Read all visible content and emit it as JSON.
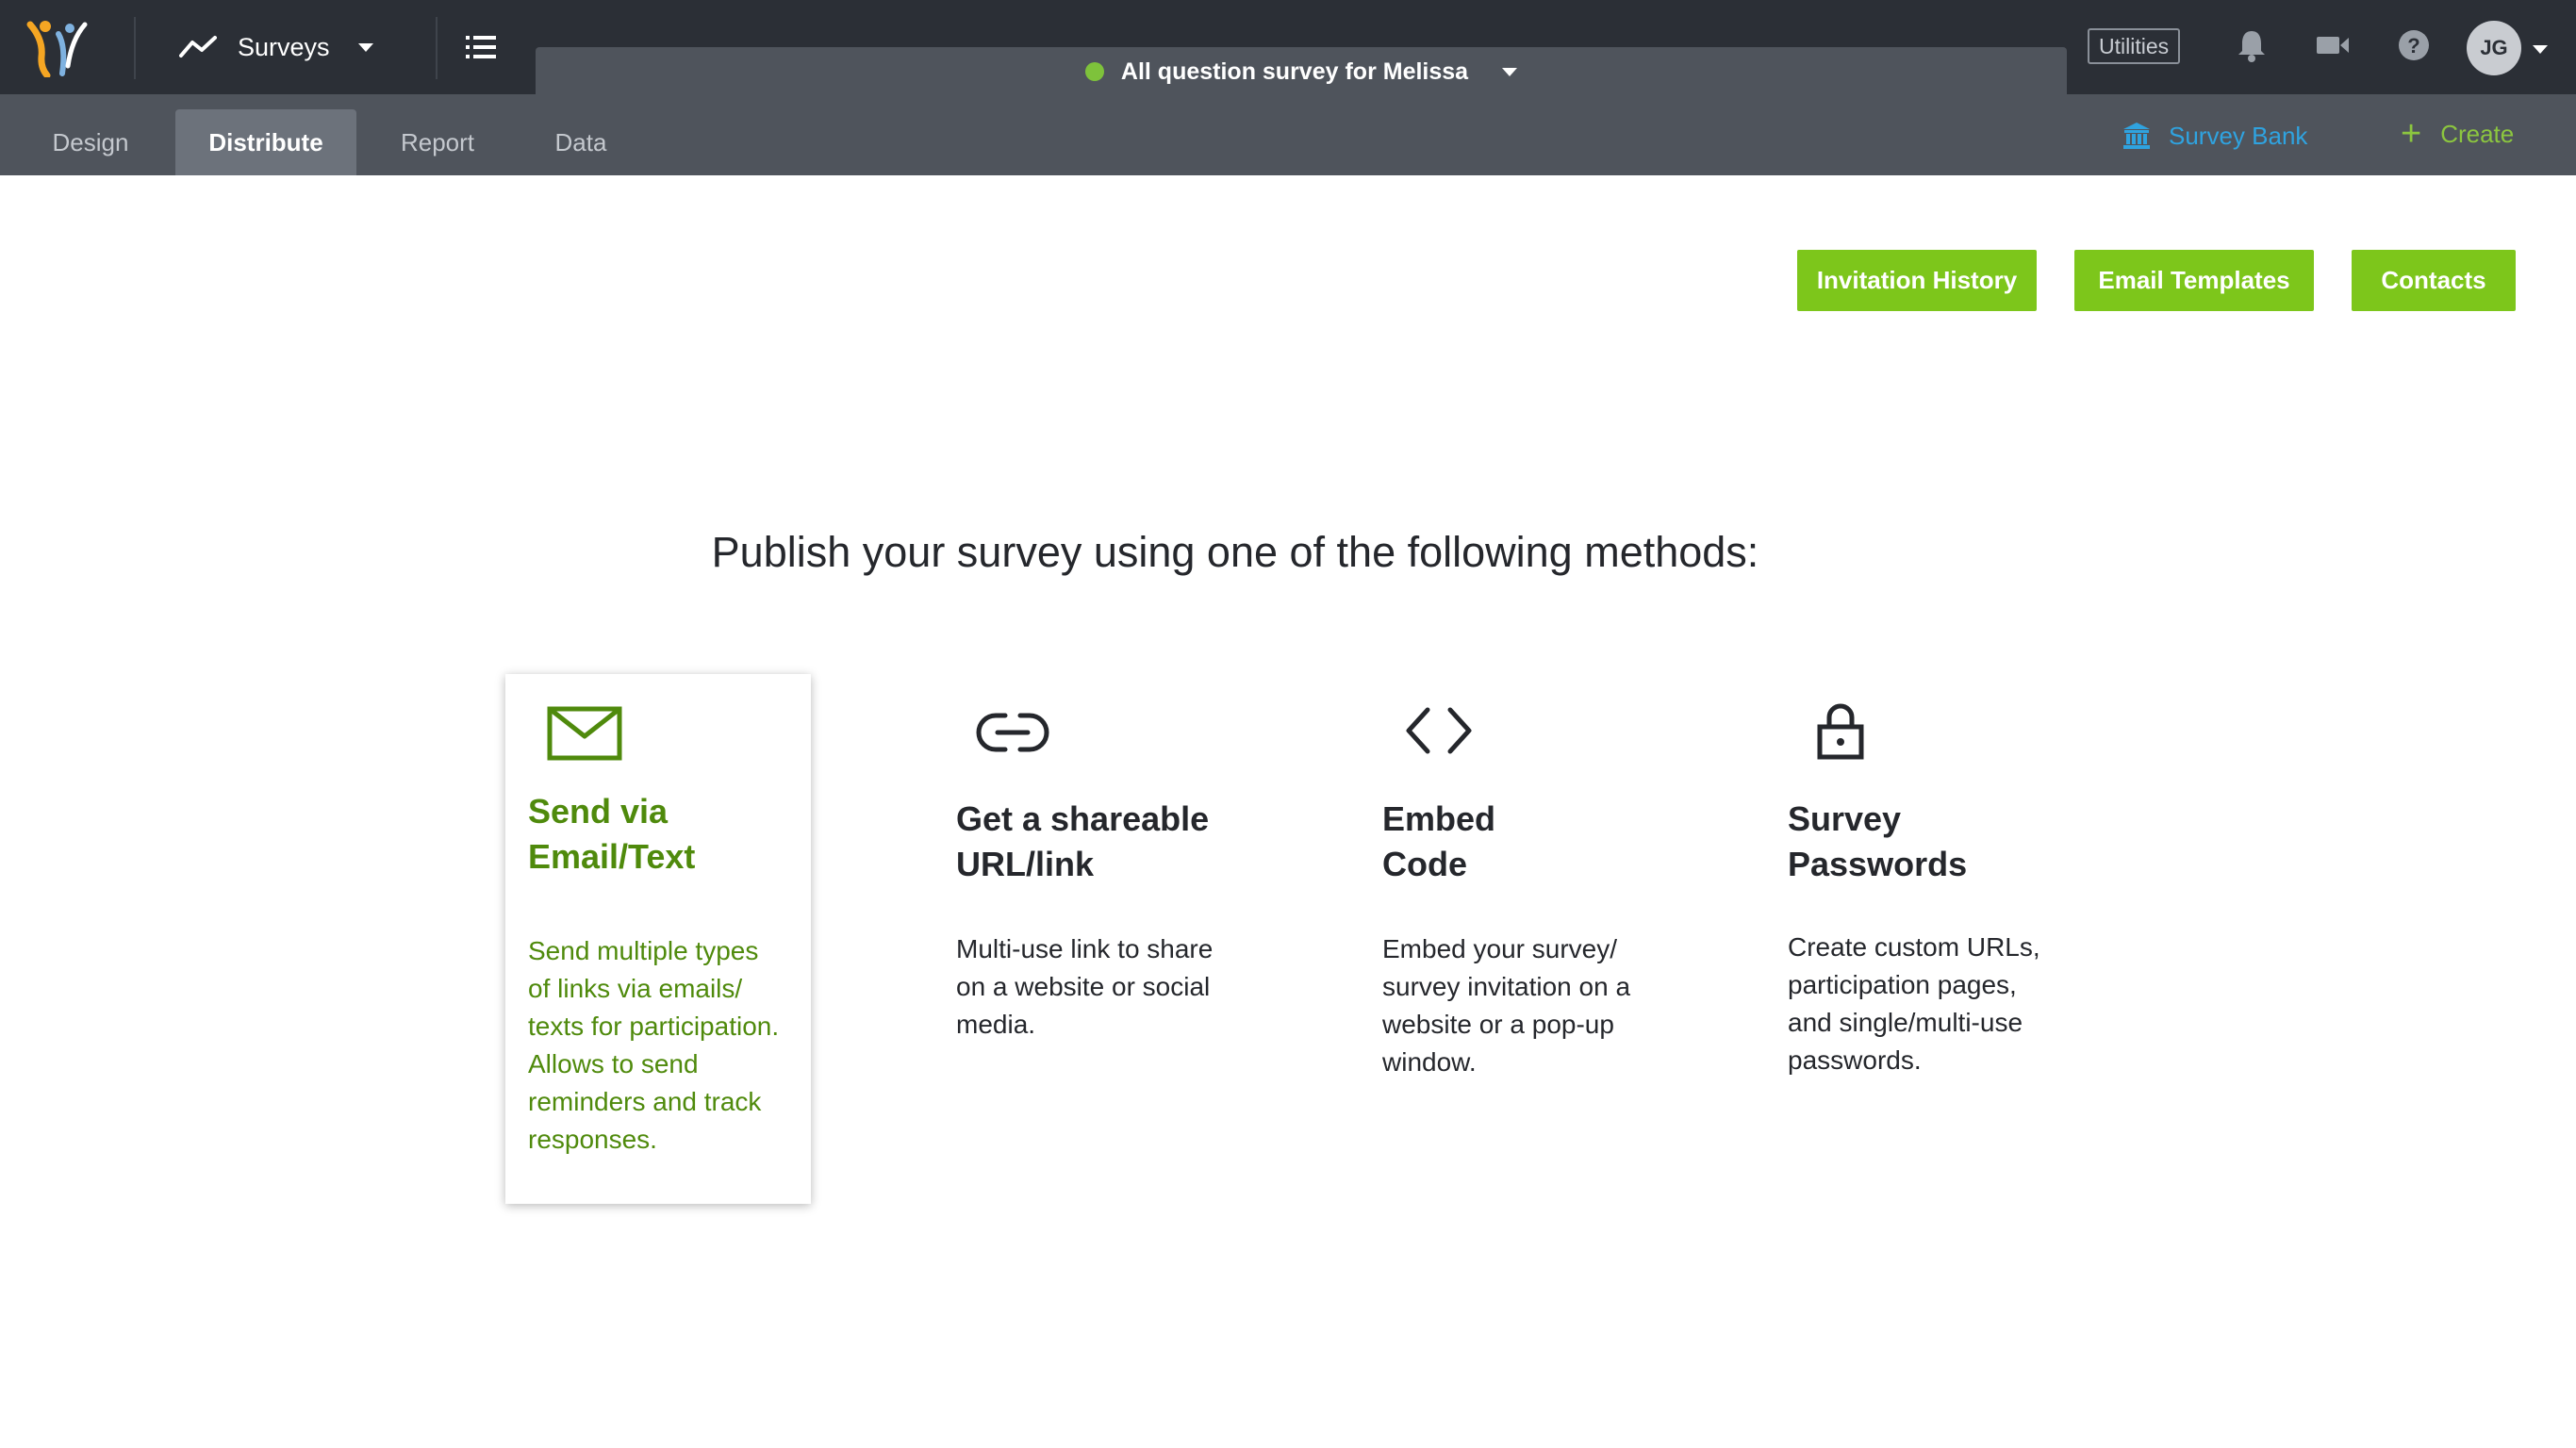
{
  "topbar": {
    "surveys_label": "Surveys",
    "survey_title": "All question survey for Melissa",
    "survey_status_color": "#7ec23b",
    "utilities_label": "Utilities",
    "user_initials": "JG",
    "icons": [
      "logo-icon",
      "trend-icon",
      "list-icon",
      "bell-icon",
      "video-icon",
      "help-icon"
    ]
  },
  "subnav": {
    "tabs": [
      {
        "label": "Design"
      },
      {
        "label": "Distribute",
        "active": true
      },
      {
        "label": "Report"
      },
      {
        "label": "Data"
      }
    ],
    "survey_bank_label": "Survey Bank",
    "create_label": "Create",
    "create_icon": "+"
  },
  "actions": {
    "invitation_history": "Invitation History",
    "email_templates": "Email Templates",
    "contacts": "Contacts",
    "color": "#7dc61b"
  },
  "main": {
    "heading": "Publish your survey using one of the following methods:",
    "methods": [
      {
        "title_line1": "Send via",
        "title_line2": "Email/Text",
        "desc": [
          "Send multiple types",
          "of links via emails/",
          "texts for participation.",
          "Allows to send",
          "reminders and track",
          "responses."
        ],
        "icon": "envelope-icon",
        "selected": true
      },
      {
        "title_line1": "Get a shareable",
        "title_line2": "URL/link",
        "desc": [
          "Multi-use link to share",
          "on a website or social",
          "media."
        ],
        "icon": "link-icon"
      },
      {
        "title_line1": "Embed",
        "title_line2": "Code",
        "desc": [
          "Embed your survey/",
          "survey invitation on a",
          "website or a pop-up",
          "window."
        ],
        "icon": "code-icon"
      },
      {
        "title_line1": "Survey",
        "title_line2": "Passwords",
        "desc": [
          "Create custom URLs,",
          "participation pages,",
          "and single/multi-use",
          "passwords."
        ],
        "icon": "lock-icon"
      }
    ]
  }
}
